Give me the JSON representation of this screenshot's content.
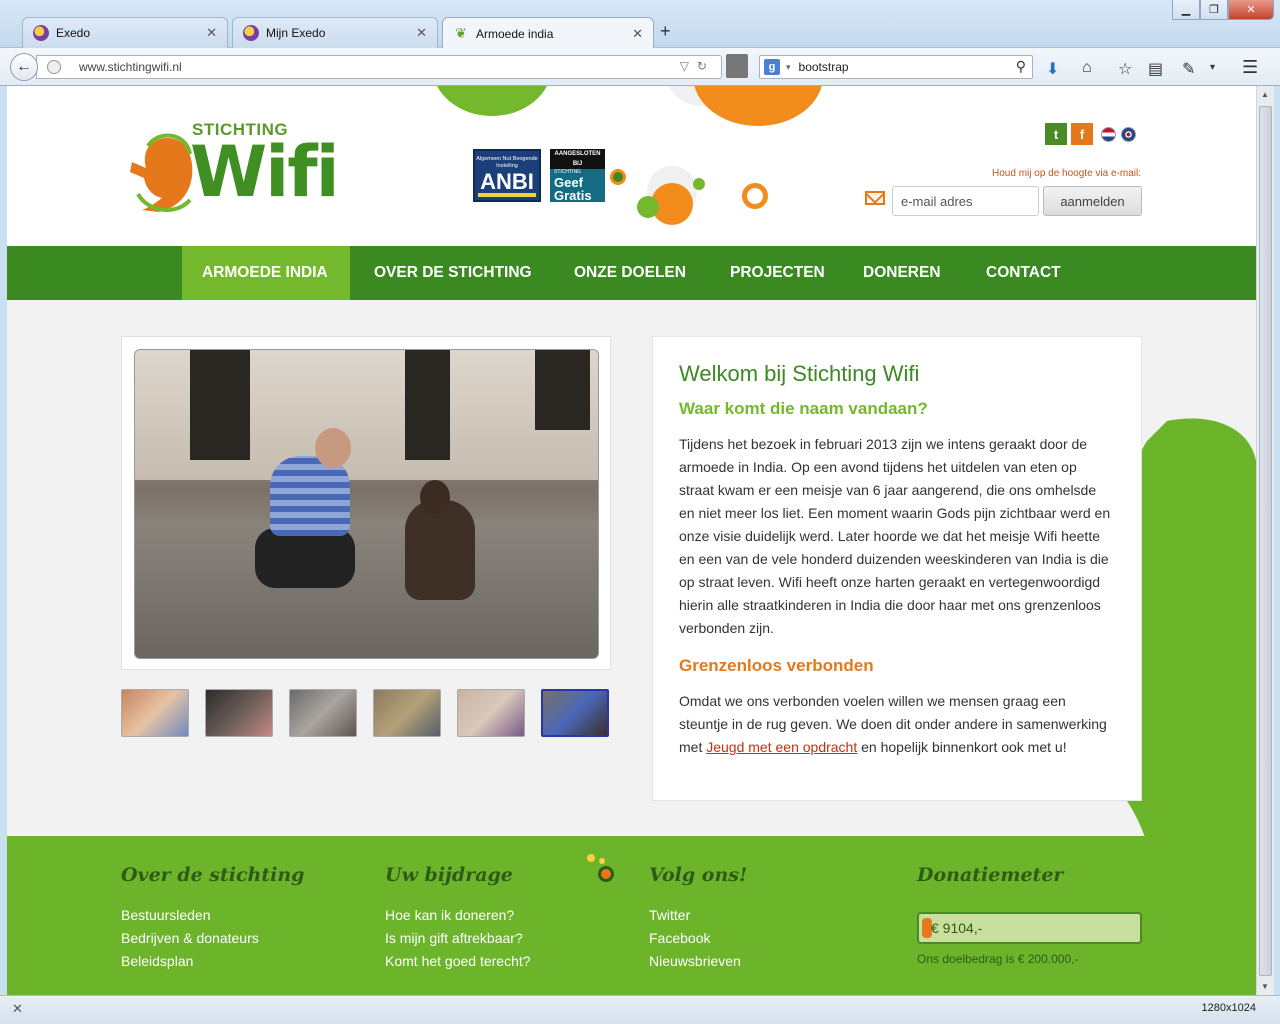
{
  "browser": {
    "tabs": [
      {
        "label": "Exedo",
        "active": false
      },
      {
        "label": "Mijn Exedo",
        "active": false
      },
      {
        "label": "Armoede india",
        "active": true
      }
    ],
    "url": "www.stichtingwifi.nl",
    "search_value": "bootstrap",
    "search_engine_icon": "google-icon",
    "status_resolution": "1280x1024"
  },
  "header": {
    "logo_top": "STICHTING",
    "logo_main": "Wifi",
    "anbi_small": "Algemeen Nut Beogende Instelling",
    "anbi_big": "ANBI",
    "geef_top": "AANGESLOTEN BIJ",
    "geef_small": "STICHTING",
    "geef_main1": "Geef",
    "geef_main2": "Gratis",
    "social": {
      "twitter": "t",
      "facebook": "f"
    },
    "newsletter_label": "Houd mij op de hoogte via e-mail:",
    "email_placeholder": "e-mail adres",
    "subscribe_label": "aanmelden"
  },
  "nav": {
    "items": [
      {
        "label": "ARMOEDE INDIA",
        "active": true
      },
      {
        "label": "OVER DE STICHTING",
        "active": false
      },
      {
        "label": "ONZE DOELEN",
        "active": false
      },
      {
        "label": "PROJECTEN",
        "active": false
      },
      {
        "label": "DONEREN",
        "active": false
      },
      {
        "label": "CONTACT",
        "active": false
      }
    ]
  },
  "gallery": {
    "thumb_count": 6,
    "active_thumb": 5
  },
  "content": {
    "title": "Welkom bij Stichting Wifi",
    "subtitle1": "Waar komt die naam vandaan?",
    "paragraph1": "Tijdens het bezoek in februari 2013 zijn we intens geraakt door de armoede in India. Op een avond tijdens het uitdelen van eten op straat kwam er een meisje van 6 jaar aangerend, die ons omhelsde en niet meer los liet. Een moment waarin Gods pijn zichtbaar werd en onze visie duidelijk werd.  Later hoorde we dat het meisje Wifi heette en een van de vele honderd duizenden weeskinderen van India is die op straat leven. Wifi heeft onze harten geraakt en vertegenwoordigd hierin alle straatkinderen in India die door haar met ons grenzenloos verbonden zijn.",
    "subtitle2": "Grenzenloos verbonden",
    "paragraph2_before": "Omdat we ons verbonden voelen willen we mensen graag een steuntje in de rug geven. We doen dit onder andere in samenwerking met ",
    "paragraph2_link": "Jeugd met een opdracht",
    "paragraph2_after": " en hopelijk binnenkort ook met u!"
  },
  "footer": {
    "col1": {
      "title": "Over de stichting",
      "links": [
        "Bestuursleden",
        "Bedrijven & donateurs",
        "Beleidsplan"
      ]
    },
    "col2": {
      "title": "Uw bijdrage",
      "links": [
        "Hoe kan ik doneren?",
        "Is mijn gift aftrekbaar?",
        "Komt het goed terecht?"
      ]
    },
    "col3": {
      "title": "Volg ons!",
      "links": [
        "Twitter",
        "Facebook",
        "Nieuwsbrieven"
      ]
    },
    "col4": {
      "title": "Donatiemeter"
    },
    "meter_value": "€ 9104,-",
    "meter_fraction": 0.0455,
    "goal_text": "Ons doelbedrag is € 200.000,-"
  },
  "colors": {
    "brand_green_dark": "#3a8a21",
    "brand_green_light": "#74b82e",
    "brand_orange": "#e5781b",
    "footer_green": "#6cb42a"
  }
}
